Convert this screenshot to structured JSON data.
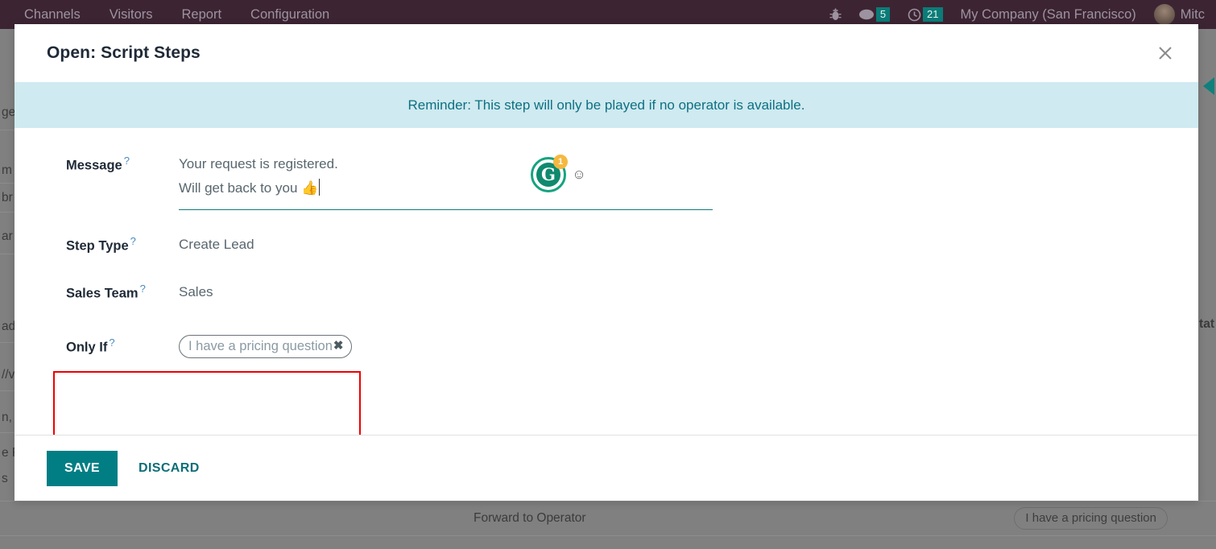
{
  "navbar": {
    "menu_items": [
      {
        "label": "Channels"
      },
      {
        "label": "Visitors"
      },
      {
        "label": "Report"
      },
      {
        "label": "Configuration"
      }
    ],
    "debug_icon": "bug-icon",
    "messages_icon": "chat-bubble-icon",
    "messages_count": "5",
    "activities_icon": "clock-icon",
    "activities_count": "21",
    "company": "My Company (San Francisco)",
    "user_name": "Mitc",
    "avatar_icon": "user-avatar"
  },
  "modal": {
    "title": "Open: Script Steps",
    "close_icon": "close-icon",
    "alert": "Reminder: This step will only be played if no operator is available.",
    "fields": {
      "message": {
        "label": "Message",
        "help": "?",
        "line1": "Your request is registered.",
        "line2": "Will get back to you ",
        "emoji": "👍"
      },
      "step_type": {
        "label": "Step Type",
        "help": "?",
        "value": "Create Lead"
      },
      "sales_team": {
        "label": "Sales Team",
        "help": "?",
        "value": "Sales"
      },
      "only_if": {
        "label": "Only If",
        "help": "?",
        "tags": [
          {
            "label": "I have a pricing question",
            "remove_icon": "✖"
          }
        ]
      }
    },
    "editor_tools": {
      "grammarly_letter": "G",
      "grammarly_count": "1",
      "emoji_picker_icon": "☺"
    },
    "footer": {
      "save_label": "SAVE",
      "discard_label": "DISCARD"
    }
  },
  "background": {
    "left_strip_rows": [
      {
        "text": "ge"
      },
      {
        "text": "m"
      },
      {
        "text": "br"
      },
      {
        "text": "ar"
      },
      {
        "text": "ad"
      },
      {
        "text": "//v"
      },
      {
        "text": "n,"
      },
      {
        "text": "e F"
      },
      {
        "text": "s"
      }
    ],
    "right_text": "tat",
    "bottom_row": {
      "label": "Forward to Operator",
      "tag": "I have a pricing question"
    }
  },
  "colors": {
    "navbar_bg": "#3c2433",
    "accent_teal": "#017e84",
    "alert_bg": "#cfeaf0",
    "alert_text": "#0d7082",
    "highlight_red": "#ef0000",
    "badge_teal": "#0b7c78",
    "grammarly_green": "#15a37f",
    "grammarly_count_orange": "#f5b840"
  }
}
